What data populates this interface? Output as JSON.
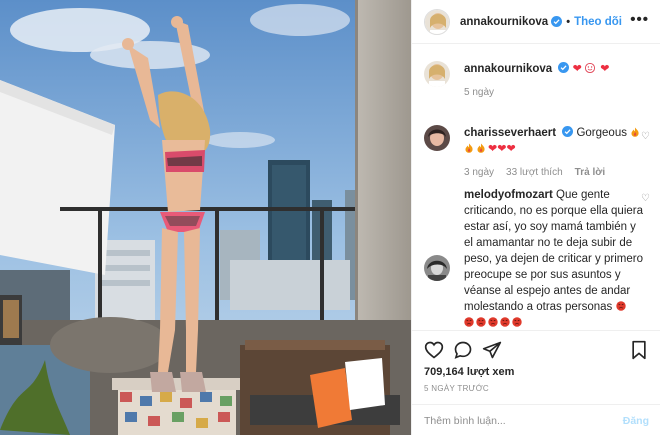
{
  "post": {
    "username": "annakournikova",
    "follow_label": "Theo dõi",
    "more_label": "•••",
    "video": {
      "description": "Woman in a colorful bikini dancing with arms raised on a rooftop terrace, city skyline behind"
    }
  },
  "comments": [
    {
      "username": "annakournikova",
      "text": "",
      "emojis": [
        "heart",
        "smiling-face-icon",
        "heart"
      ],
      "time": "5 ngày"
    },
    {
      "username": "charisseverhaert",
      "text": "Gorgeous",
      "emojis_line2": [
        "fire",
        "fire",
        "heart",
        "heart",
        "heart"
      ],
      "time": "3 ngày",
      "likes": "33 lượt thích",
      "reply_label": "Trả lời"
    },
    {
      "username": "melodyofmozart",
      "text": "Que gente criticando, no es porque ella quiera estar así, yo soy mamá también y el amamantar no te deja subir de peso, ya dejen de criticar y primero preocupe se por sus asuntos y véanse al espejo antes de andar molestando a otras personas",
      "emojis_line2": [
        "angry",
        "angry",
        "angry",
        "angry",
        "angry"
      ]
    }
  ],
  "stats": {
    "views": "709,164 lượt xem",
    "timestamp": "5 NGÀY TRƯỚC"
  },
  "composer": {
    "placeholder": "Thêm bình luận...",
    "post_label": "Đăng"
  },
  "colors": {
    "accent": "#3897f0",
    "heart": "#ed2f41",
    "muted": "#8e8e8e"
  }
}
